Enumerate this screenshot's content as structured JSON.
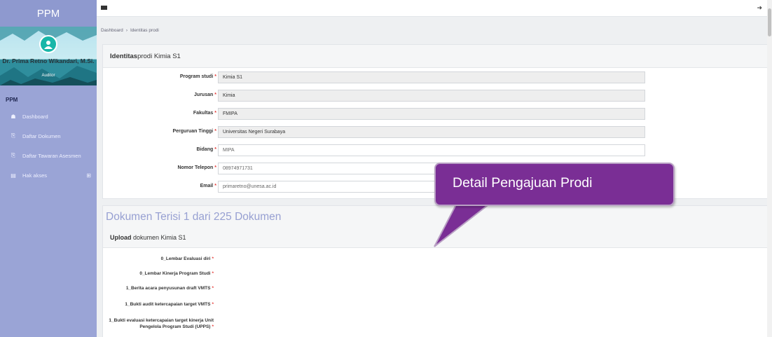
{
  "sidebar": {
    "brand": "PPM",
    "profile": {
      "name": "Dr. Prima Retno Wikandari, M.Si.",
      "role": "Auditor"
    },
    "section_title": "PPM",
    "items": [
      {
        "label": "Dashboard",
        "icon": "dashboard-icon"
      },
      {
        "label": "Daftar Dokumen",
        "icon": "documents-icon"
      },
      {
        "label": "Daftar Tawaran Asesmen",
        "icon": "assessment-icon"
      },
      {
        "label": "Hak akses",
        "icon": "access-icon",
        "expand": "⊞"
      }
    ]
  },
  "topbar": {
    "menu_icon": "hamburger-icon",
    "logout_icon": "logout-icon"
  },
  "breadcrumb": {
    "home": "Dashboard",
    "separator": "›",
    "current": "Identitas prodi"
  },
  "identity_panel": {
    "title_bold": "Identitas",
    "title_rest": " prodi Kimia S1",
    "fields": [
      {
        "label": "Program studi",
        "value": "Kimia S1",
        "readonly": true
      },
      {
        "label": "Jurusan",
        "value": "Kimia",
        "readonly": true
      },
      {
        "label": "Fakultas",
        "value": "FMIPA",
        "readonly": true
      },
      {
        "label": "Perguruan Tinggi",
        "value": "Universitas Negeri Surabaya",
        "readonly": true
      },
      {
        "label": "Bidang",
        "value": "MIPA",
        "readonly": false
      },
      {
        "label": "Nomor Telepon",
        "value": "08974971731",
        "readonly": false
      },
      {
        "label": "Email",
        "value": "primaretno@unesa.ac.id",
        "readonly": false
      }
    ],
    "required_mark": "*"
  },
  "documents_panel": {
    "count_text": "Dokumen Terisi 1 dari 225 Dokumen",
    "upload_bold": "Upload",
    "upload_rest": " dokumen Kimia S1",
    "items": [
      "0_Lembar Evaluasi diri",
      "0_Lembar Kinerja Program Studi",
      "1_Berita acara penyusunan draft VMTS",
      "1_Bukti audit ketercapaian target VMTS",
      "1_Bukti evaluasi ketercapaian target kinerja Unit Pengelola Program Studi (UPPS)"
    ]
  },
  "callout": {
    "text": "Detail Pengajuan Prodi",
    "color": "#7a2e95"
  },
  "colors": {
    "sidebar": "#9aa4d6",
    "accent": "#97a0d2",
    "required": "#e53935"
  }
}
